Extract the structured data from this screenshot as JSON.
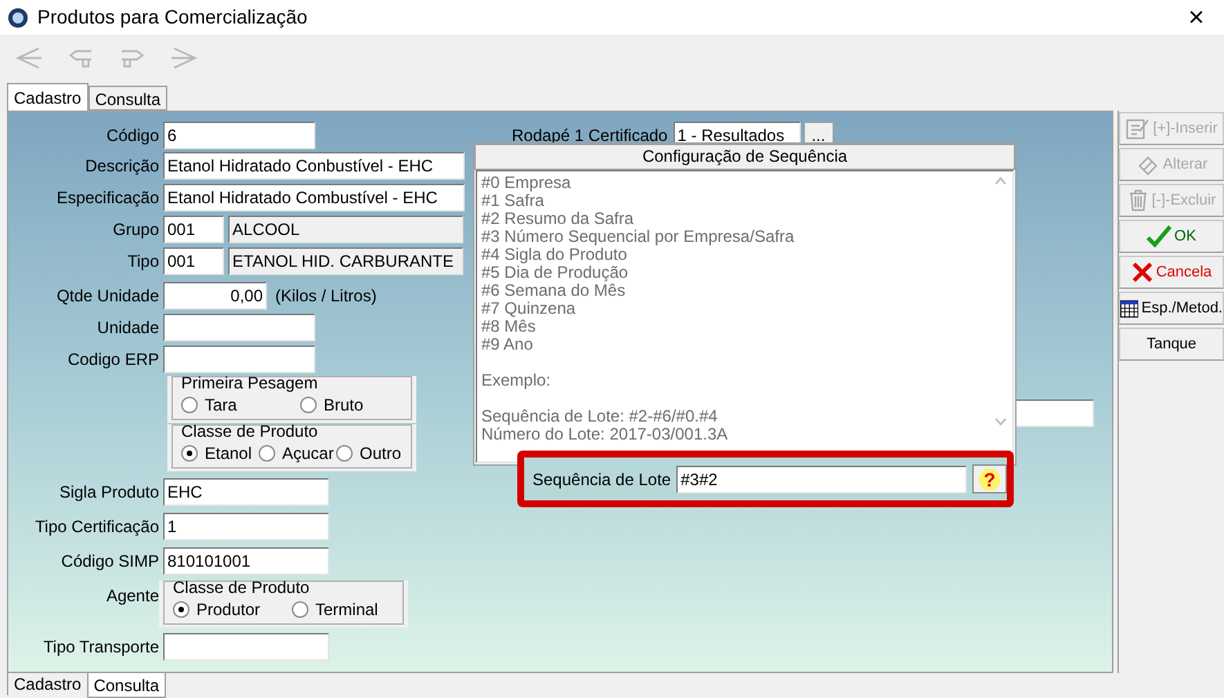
{
  "window": {
    "title": "Produtos para Comercialização",
    "close": "×"
  },
  "toolbar": [
    {
      "kind": "first",
      "disabled": true
    },
    {
      "kind": "prev",
      "disabled": true
    },
    {
      "kind": "next",
      "disabled": true
    },
    {
      "kind": "last",
      "disabled": true
    }
  ],
  "tabs": [
    {
      "label": "Cadastro",
      "selected": true
    },
    {
      "label": "Consulta",
      "selected": false
    }
  ],
  "form": {
    "codigo": {
      "label": "Código",
      "value": "6"
    },
    "rodape": {
      "label": "Rodapé 1 Certificado",
      "value": "1 - Resultados",
      "button": "..."
    },
    "descricao": {
      "label": "Descrição",
      "value": "Etanol Hidratado Conbustível - EHC"
    },
    "especificacao": {
      "label": "Especificação",
      "value": "Etanol Hidratado Combustível - EHC"
    },
    "grupo": {
      "label": "Grupo",
      "code": "001",
      "name": "ALCOOL"
    },
    "tipo": {
      "label": "Tipo",
      "code": "001",
      "name": "ETANOL HID. CARBURANTE"
    },
    "qtde": {
      "label": "Qtde Unidade",
      "value": "0,00",
      "unit": "(Kilos / Litros)"
    },
    "unidade": {
      "label": "Unidade"
    },
    "erp": {
      "label": "Codigo ERP"
    },
    "primeira_pesagem": {
      "title": "Primeira Pesagem",
      "options": [
        {
          "label": "Tara",
          "selected": false
        },
        {
          "label": "Bruto",
          "selected": false
        }
      ]
    },
    "classe": {
      "title": "Classe de Produto",
      "options": [
        {
          "label": "Etanol",
          "selected": true
        },
        {
          "label": "Açucar",
          "selected": false
        },
        {
          "label": "Outro",
          "selected": false
        }
      ]
    },
    "sigla": {
      "label": "Sigla Produto",
      "value": "EHC"
    },
    "certificacao": {
      "label": "Tipo Certificação",
      "value": "1"
    },
    "simp": {
      "label": "Código SIMP",
      "value": "810101001"
    },
    "agente": {
      "label": "Agente",
      "title": "Classe de Produto",
      "options": [
        {
          "label": "Produtor",
          "selected": true
        },
        {
          "label": "Terminal",
          "selected": false
        }
      ]
    },
    "transporte": {
      "label": "Tipo Transporte"
    }
  },
  "popup": {
    "title": "Configuração de Sequência",
    "paragraphs": [
      [
        "#0 Empresa",
        "#1 Safra",
        "#2 Resumo da Safra",
        "#3 Número Sequencial por Empresa/Safra",
        "#4 Sigla do Produto",
        "#5 Dia de Produção",
        "#6 Semana do Mês",
        "#7 Quinzena",
        "#8 Mês",
        "#9 Ano"
      ],
      [
        "Exemplo:"
      ],
      [
        "Sequência de Lote: #2-#6/#0.#4",
        "Número do Lote: 2017-03/001.3A"
      ]
    ]
  },
  "sequencia": {
    "label": "Sequência de Lote",
    "value": "#3#2",
    "help": "?"
  },
  "side_buttons": [
    {
      "kind": "insert",
      "label": "[+]-Inserir",
      "disabled": true
    },
    {
      "kind": "edit",
      "label": "Alterar",
      "disabled": true
    },
    {
      "kind": "delete",
      "label": "[-]-Excluir",
      "disabled": true
    },
    {
      "kind": "ok",
      "label": "OK",
      "disabled": false
    },
    {
      "kind": "cancel",
      "label": "Cancela",
      "disabled": false
    },
    {
      "kind": "table",
      "label": "Esp./Metod.",
      "disabled": false
    },
    {
      "kind": "plain",
      "label": "Tanque",
      "disabled": false
    }
  ],
  "bottom_tabs": [
    {
      "label": "Cadastro",
      "selected": false
    },
    {
      "label": "Consulta",
      "selected": true
    }
  ]
}
